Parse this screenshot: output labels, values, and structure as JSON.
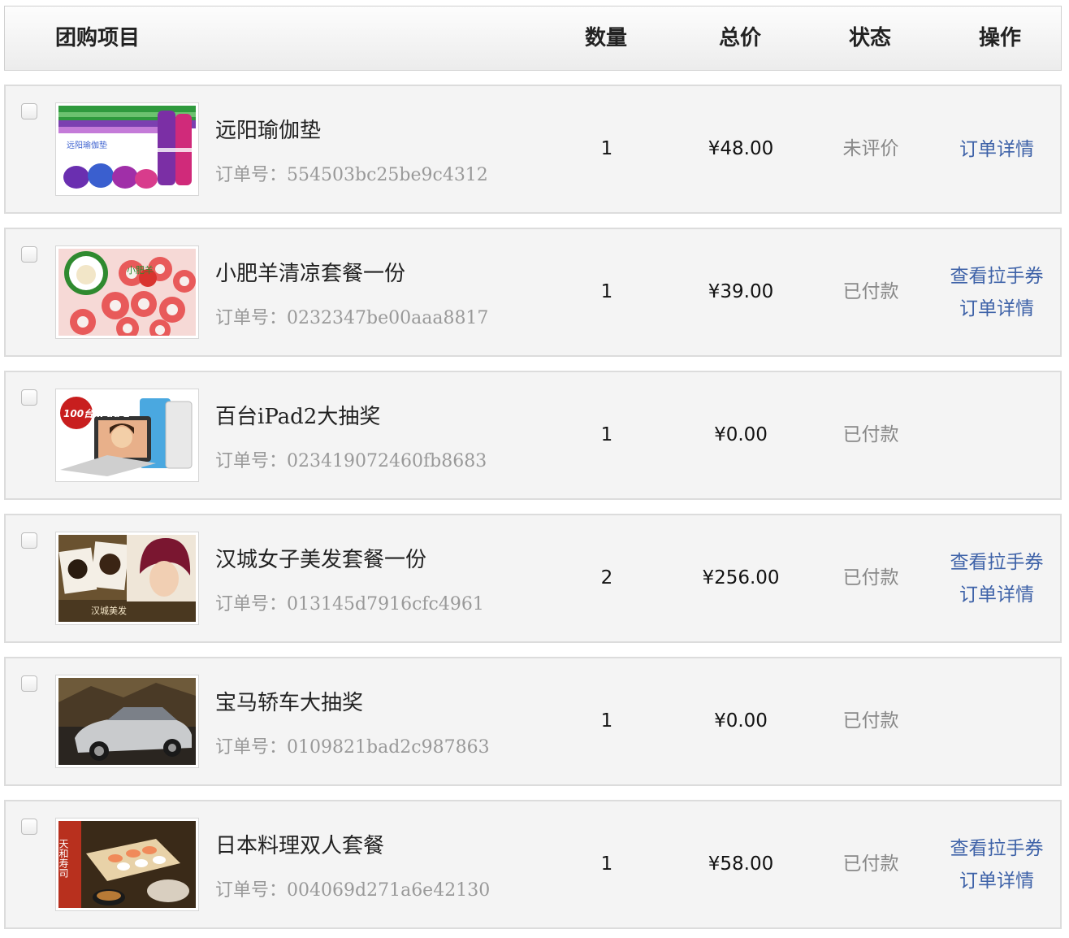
{
  "table": {
    "headers": {
      "item": "团购项目",
      "qty": "数量",
      "total": "总价",
      "status": "状态",
      "op": "操作"
    },
    "order_label": "订单号：",
    "rows": [
      {
        "name": "远阳瑜伽垫",
        "order_no": "554503bc25be9c4312",
        "qty": "1",
        "price": "¥48.00",
        "status": "未评价",
        "links": [
          "订单详情"
        ],
        "thumb_icon": "yoga-mat-image",
        "thumb_text": "远阳瑜伽垫"
      },
      {
        "name": "小肥羊清凉套餐一份",
        "order_no": "0232347be00aaa8817",
        "qty": "1",
        "price": "¥39.00",
        "status": "已付款",
        "links": [
          "查看拉手券",
          "订单详情"
        ],
        "thumb_icon": "lamb-rolls-image",
        "thumb_text": "小肥羊"
      },
      {
        "name": "百台iPad2大抽奖",
        "order_no": "023419072460fb8683",
        "qty": "1",
        "price": "¥0.00",
        "status": "已付款",
        "links": [],
        "thumb_icon": "ipad-image",
        "thumb_text": "100台 iPad 2"
      },
      {
        "name": "汉城女子美发套餐一份",
        "order_no": "013145d7916cfc4961",
        "qty": "2",
        "price": "¥256.00",
        "status": "已付款",
        "links": [
          "查看拉手券",
          "订单详情"
        ],
        "thumb_icon": "hair-salon-image",
        "thumb_text": "汉城美发"
      },
      {
        "name": "宝马轿车大抽奖",
        "order_no": "0109821bad2c987863",
        "qty": "1",
        "price": "¥0.00",
        "status": "已付款",
        "links": [],
        "thumb_icon": "bmw-car-image",
        "thumb_text": ""
      },
      {
        "name": "日本料理双人套餐",
        "order_no": "004069d271a6e42130",
        "qty": "1",
        "price": "¥58.00",
        "status": "已付款",
        "links": [
          "查看拉手券",
          "订单详情"
        ],
        "thumb_icon": "sushi-image",
        "thumb_text": "天和寿司"
      }
    ]
  },
  "colors": {
    "link": "#3e62a8",
    "row_bg": "#f4f4f4",
    "border": "#dcdcdc",
    "muted": "#999999"
  }
}
